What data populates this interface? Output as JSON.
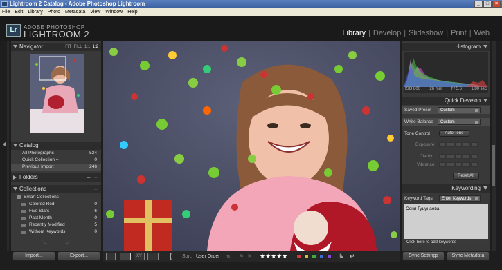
{
  "window": {
    "title": "Lightroom 2 Catalog - Adobe Photoshop Lightroom"
  },
  "menu": [
    "File",
    "Edit",
    "Library",
    "Photo",
    "Metadata",
    "View",
    "Window",
    "Help"
  ],
  "brand": {
    "line1": "ADOBE PHOTOSHOP",
    "line2": "LIGHTROOM 2",
    "logo": "Lr"
  },
  "modules": {
    "library": "Library",
    "develop": "Develop",
    "slideshow": "Slideshow",
    "print": "Print",
    "web": "Web",
    "sep": "|"
  },
  "navigator": {
    "title": "Navigator",
    "zoom": [
      "FIT",
      "FILL",
      "1:1",
      "1:2"
    ]
  },
  "catalog": {
    "title": "Catalog",
    "items": [
      {
        "label": "All Photographs",
        "count": "524"
      },
      {
        "label": "Quick Collection +",
        "count": "0"
      },
      {
        "label": "Previous Import",
        "count": "246"
      }
    ]
  },
  "folders": {
    "title": "Folders",
    "actions": [
      "−",
      "+"
    ]
  },
  "collections": {
    "title": "Collections",
    "add": "+",
    "group": "Smart Collections",
    "items": [
      {
        "label": "Colored Red",
        "count": "0"
      },
      {
        "label": "Five Stars",
        "count": "6"
      },
      {
        "label": "Past Month",
        "count": "0"
      },
      {
        "label": "Recently Modified",
        "count": "5"
      },
      {
        "label": "Without Keywords",
        "count": "0"
      }
    ]
  },
  "left_buttons": {
    "import": "Import...",
    "export": "Export..."
  },
  "histogram": {
    "title": "Histogram",
    "iso": "ISO 800",
    "focal": "26 mm",
    "aperture": "f / 5,6",
    "shutter": "1/80 sec"
  },
  "quick_develop": {
    "title": "Quick Develop",
    "saved_preset_label": "Saved Preset",
    "saved_preset_value": "Custom",
    "white_balance_label": "White Balance",
    "white_balance_value": "Custom",
    "tone_control_label": "Tone Control",
    "auto_tone": "Auto Tone",
    "exposure": "Exposure",
    "clarity": "Clarity",
    "vibrance": "Vibrance",
    "reset_all": "Reset All"
  },
  "keywording": {
    "title": "Keywording",
    "tags_label": "Keyword Tags",
    "tags_mode": "Enter Keywords",
    "keyword": "Соня Гуцунаева",
    "hint": "Click here to add keywords"
  },
  "right_buttons": {
    "sync_settings": "Sync Settings",
    "sync_metadata": "Sync Metadata"
  },
  "toolbar": {
    "sort_label": "Sort:",
    "sort_value": "User Order",
    "stars": "★★★★★",
    "color_labels": [
      "#d23a3a",
      "#d6c23a",
      "#3fae3f",
      "#3a6fd6",
      "#8a4ad6"
    ]
  },
  "colors": {
    "panel": "#393939",
    "accent": "#5a7fbf"
  }
}
